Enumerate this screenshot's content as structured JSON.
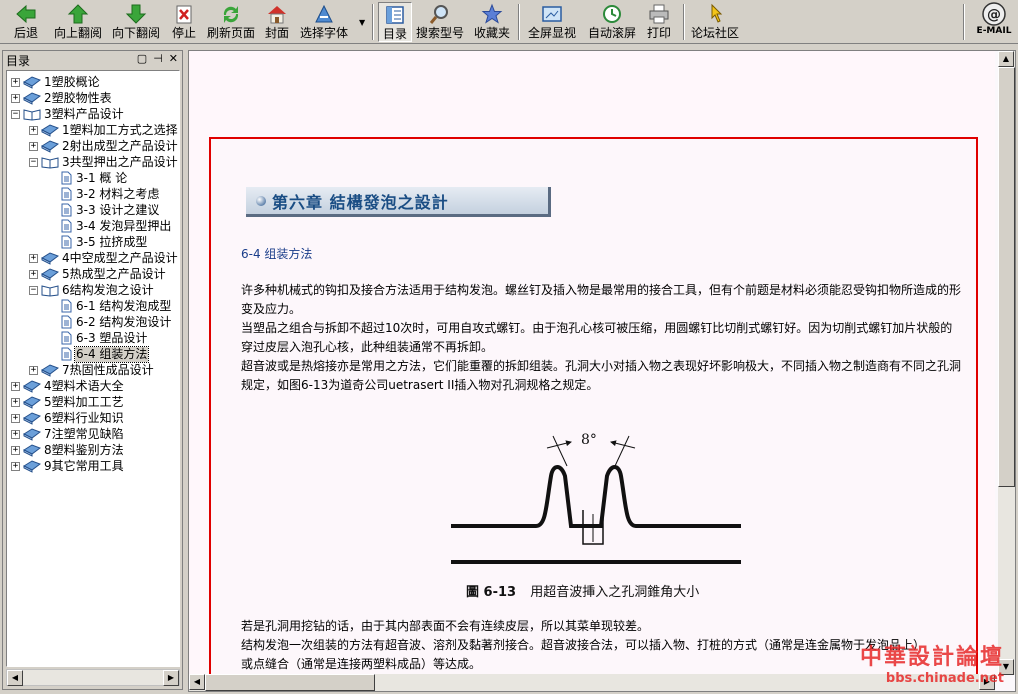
{
  "toolbar": {
    "buttons": [
      {
        "label": "后退"
      },
      {
        "label": "向上翻阅"
      },
      {
        "label": "向下翻阅"
      },
      {
        "label": "停止"
      },
      {
        "label": "刷新页面"
      },
      {
        "label": "封面"
      },
      {
        "label": "选择字体"
      },
      {
        "label": "目录"
      },
      {
        "label": "搜索型号"
      },
      {
        "label": "收藏夹"
      },
      {
        "label": "全屏显视"
      },
      {
        "label": "自动滚屏"
      },
      {
        "label": "打印"
      },
      {
        "label": "论坛社区"
      }
    ],
    "email_label": "E-MAIL"
  },
  "panel": {
    "title": "目录",
    "tree": [
      {
        "label": "1塑胶概论"
      },
      {
        "label": "2塑胶物性表"
      },
      {
        "label": "3塑料产品设计"
      },
      {
        "label": "1塑料加工方式之选择"
      },
      {
        "label": "2射出成型之产品设计"
      },
      {
        "label": "3共型押出之产品设计"
      },
      {
        "label": "3-1 概 论"
      },
      {
        "label": "3-2 材料之考虑"
      },
      {
        "label": "3-3 设计之建议"
      },
      {
        "label": "3-4 发泡异型押出"
      },
      {
        "label": "3-5 拉挤成型"
      },
      {
        "label": "4中空成型之产品设计"
      },
      {
        "label": "5热成型之产品设计"
      },
      {
        "label": "6结构发泡之设计"
      },
      {
        "label": "6-1 结构发泡成型"
      },
      {
        "label": "6-2 结构发泡设计"
      },
      {
        "label": "6-3 塑品设计"
      },
      {
        "label": "6-4 组装方法"
      },
      {
        "label": "7热固性成品设计"
      },
      {
        "label": "4塑料术语大全"
      },
      {
        "label": "5塑料加工工艺"
      },
      {
        "label": "6塑料行业知识"
      },
      {
        "label": "7注塑常见缺陷"
      },
      {
        "label": "8塑料鉴别方法"
      },
      {
        "label": "9其它常用工具"
      }
    ]
  },
  "content": {
    "chapter_title": "第六章  結構發泡之設計",
    "section_title": "6-4  组装方法",
    "paragraphs": [
      "许多种机械式的钩扣及接合方法适用于结构发泡。螺丝钉及插入物是最常用的接合工具，但有个前题是材料必须能忍受钩扣物所造成的形变及应力。",
      "当塑品之组合与拆卸不超过10次时，可用自攻式螺钉。由于泡孔心核可被压缩，用圆螺钉比切削式螺钉好。因为切削式螺钉加片状般的穿过皮层入泡孔心核，此种组装通常不再拆卸。",
      "超音波或是热熔接亦是常用之方法，它们能重覆的拆卸组装。孔洞大小对插入物之表现好坏影响极大，不同插入物之制造商有不同之孔洞规定，如图6-13为道奇公司uetrasert II插入物对孔洞规格之规定。",
      "若是孔洞用挖钻的话，由于其内部表面不会有连续皮层，所以其菜单现较差。",
      "结构发泡一次组装的方法有超音波、溶剂及黏著剂接合。超音波接合法，可以插入物、打桩的方式（通常是连金属物于发泡品上）",
      "或点缝合（通常是连接两塑料成品）等达成。"
    ],
    "figure_angle": "8°",
    "figure_caption_num": "圖 6-13",
    "figure_caption_text": "用超音波挿入之孔洞錐角大小"
  },
  "watermark": {
    "line1": "中華設計論壇",
    "line2": "bbs.chinade.net"
  }
}
